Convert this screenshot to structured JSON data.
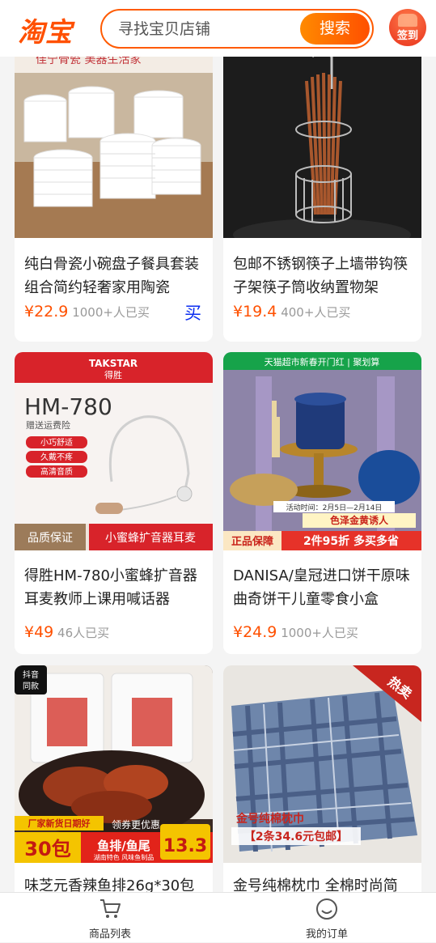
{
  "header": {
    "logo": "淘宝",
    "search_placeholder": "寻找宝贝店铺",
    "search_button": "搜索",
    "signin_label": "签到"
  },
  "products": [
    {
      "title": "纯白骨瓷小碗盘子餐具套装组合简约轻奢家用陶瓷",
      "price": "¥22.9",
      "sales": "1000+人已买",
      "buy_label": "买",
      "banner": "佳宁骨瓷  美器生活家"
    },
    {
      "title": "包邮不锈钢筷子上墙带钩筷子架筷子筒收纳置物架",
      "price": "¥19.4",
      "sales": "400+人已买"
    },
    {
      "title": "得胜HM-780小蜜蜂扩音器耳麦教师上课用喊话器",
      "price": "¥49",
      "sales": "46人已买",
      "image_text": {
        "brand": "TAKSTAR",
        "brand_cn": "得胜",
        "model": "HM-780",
        "gift": "赠送运费险",
        "features": [
          "小巧舒适",
          "久戴不疼",
          "高清音质"
        ],
        "badge": "品质保证",
        "caption": "小蜜蜂扩音器耳麦"
      }
    },
    {
      "title": "DANISA/皇冠进口饼干原味曲奇饼干儿童零食小盒",
      "price": "¥24.9",
      "sales": "1000+人已买",
      "image_text": {
        "top": "天猫超市新春开门红 | 聚划算",
        "date": "活动时间：2月5日—2月14日",
        "gift": "色泽金黄诱人",
        "badge": "正品保障",
        "promo": "2件95折 多买多省"
      }
    },
    {
      "title": "味芝元香辣鱼排26g*30包",
      "price": "",
      "sales": "",
      "image_text": {
        "tag1": "抖音",
        "tag2": "同款",
        "banner": "厂家新货日期好",
        "coupon": "领券更优惠",
        "count": "30包",
        "name": "鱼排/鱼尾",
        "sub": "湖南特色 风味鱼制品",
        "price": "13.3"
      }
    },
    {
      "title": "金号纯棉枕巾 全棉时尚简",
      "price": "",
      "sales": "",
      "image_text": {
        "hot": "热卖",
        "name": "金号纯棉枕巾",
        "promo": "【2条34.6元包邮】"
      }
    }
  ],
  "tabbar": {
    "tabs": [
      {
        "label": "商品列表"
      },
      {
        "label": "我的订单"
      }
    ]
  }
}
